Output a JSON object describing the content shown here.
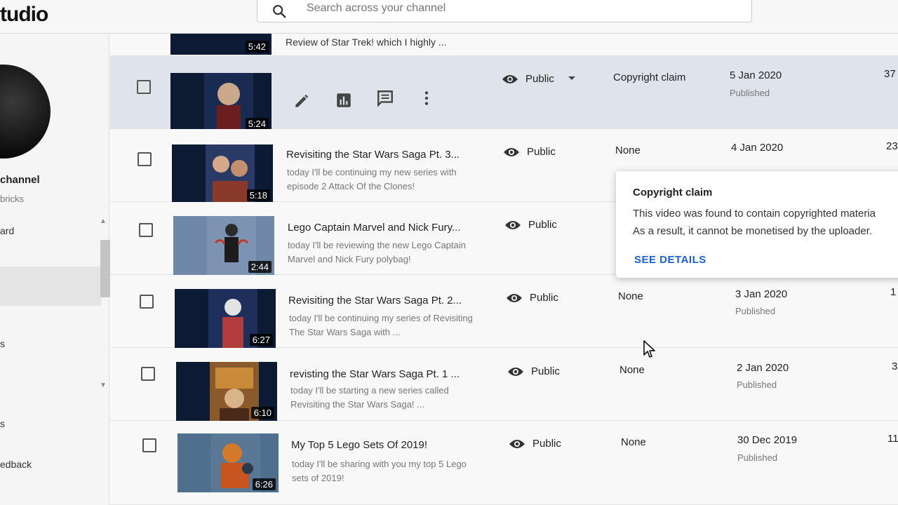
{
  "app": {
    "logo_text": "tudio"
  },
  "search": {
    "placeholder": "Search across your channel"
  },
  "sidebar": {
    "channel_name": "channel",
    "channel_handle": "bricks",
    "nav_items": [
      "ard",
      "s",
      "s",
      "edback"
    ]
  },
  "rows": [
    {
      "title": "",
      "description": "Review of Star Trek! which I highly ...",
      "duration": "5:42"
    },
    {
      "title": "",
      "description": "",
      "duration": "5:24",
      "visibility": "Public",
      "restrictions": "Copyright claim",
      "date": "5 Jan 2020",
      "status": "Published",
      "views": "37"
    },
    {
      "title": "Revisiting the Star Wars Saga Pt. 3...",
      "description": "today I'll be continuing my new series with episode 2 Attack Of the Clones!",
      "duration": "5:18",
      "visibility": "Public",
      "restrictions": "None",
      "date": "4 Jan 2020",
      "status": "",
      "views": "23"
    },
    {
      "title": "Lego Captain Marvel and Nick Fury...",
      "description": "today I'll be reviewing the new Lego Captain Marvel and Nick Fury polybag!",
      "duration": "2:44",
      "visibility": "Public",
      "restrictions": "",
      "date": "",
      "status": "",
      "views": ""
    },
    {
      "title": "Revisiting the Star Wars Saga Pt. 2...",
      "description": "today I'll be continuing my series of Revisiting The Star Wars Saga with ...",
      "duration": "6:27",
      "visibility": "Public",
      "restrictions": "None",
      "date": "3 Jan 2020",
      "status": "Published",
      "views": "1"
    },
    {
      "title": "revisting the Star Wars Saga Pt. 1 ...",
      "description": "today I'll be starting a new series called Revisiting the Star Wars Saga! ...",
      "duration": "6:10",
      "visibility": "Public",
      "restrictions": "None",
      "date": "2 Jan 2020",
      "status": "Published",
      "views": "3"
    },
    {
      "title": "My Top 5 Lego Sets Of 2019!",
      "description": "today I'll be sharing with you my top 5 Lego sets of 2019!",
      "duration": "6:26",
      "visibility": "Public",
      "restrictions": "None",
      "date": "30 Dec 2019",
      "status": "Published",
      "views": "11"
    }
  ],
  "tooltip": {
    "title": "Copyright claim",
    "line1": "This video was found to contain copyrighted materia",
    "line2": "As a result, it cannot be monetised by the uploader.",
    "link": "SEE DETAILS"
  },
  "colors": {
    "highlight_row": "#dfe3ea",
    "link": "#1a5fd6",
    "background": "#f4f4f4"
  }
}
